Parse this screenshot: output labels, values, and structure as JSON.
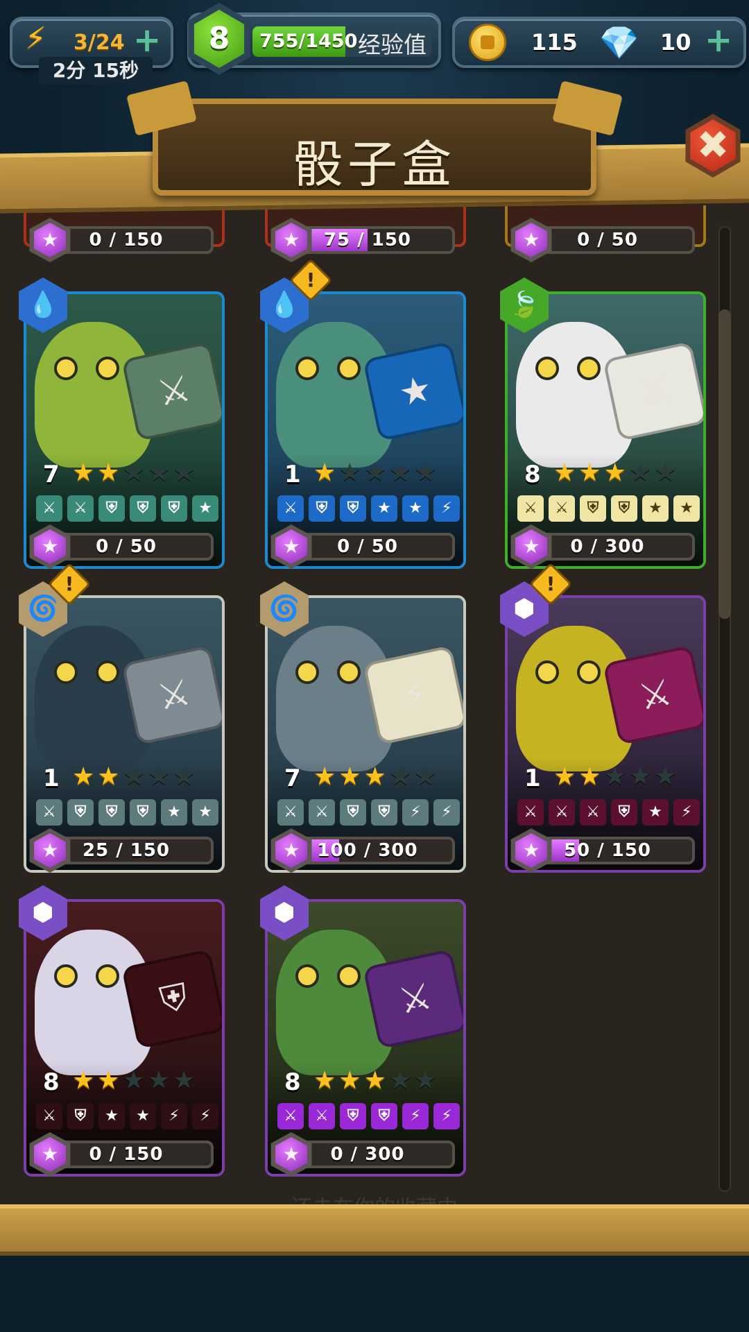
{
  "topbar": {
    "energy": "3/24",
    "energy_timer": "2分 15秒",
    "level": "8",
    "xp": "755/1450",
    "xp_fraction": 0.52,
    "xp_label": "经验值",
    "coins": "115",
    "gems": "10",
    "plus": "+"
  },
  "title": "骰子盒",
  "close_symbol": "✖",
  "footer_text": "还未在你的收藏中",
  "partial_row": [
    {
      "progress": "0 / 150",
      "fraction": 0
    },
    {
      "progress": "75 / 150",
      "fraction": 0.5
    },
    {
      "progress": "0 / 50",
      "fraction": 0
    }
  ],
  "cards": [
    {
      "level": "7",
      "stars": 2,
      "element": "water",
      "element_icon": "💧",
      "alert": false,
      "progress": "0 / 50",
      "fraction": 0,
      "faces": [
        "sword",
        "sword",
        "shield",
        "shield",
        "shield",
        "star"
      ],
      "frame": "#1c8ad0",
      "badge_color": "#2d6fd1",
      "face_bg": "#3a8a78",
      "dice_color": "#5b7f67",
      "dice_glyph": "⚔",
      "char_color": "#8fb63a",
      "bg": "linear-gradient(#2e5a4a,#1a3b2f)"
    },
    {
      "level": "1",
      "stars": 1,
      "element": "water",
      "element_icon": "💧",
      "alert": true,
      "progress": "0 / 50",
      "fraction": 0,
      "faces": [
        "sword",
        "shield",
        "shield",
        "star",
        "star",
        "bolt"
      ],
      "frame": "#1c8ad0",
      "badge_color": "#2d6fd1",
      "face_bg": "#1d6ac8",
      "dice_color": "#1667b8",
      "dice_glyph": "★",
      "char_color": "#4a8f7b",
      "bg": "linear-gradient(#2b5c7a,#183850)"
    },
    {
      "level": "8",
      "stars": 3,
      "element": "nature",
      "element_icon": "🍃",
      "alert": false,
      "progress": "0 / 300",
      "fraction": 0,
      "faces": [
        "sword",
        "sword",
        "shield",
        "shield",
        "star",
        "star"
      ],
      "frame": "#3fae2a",
      "badge_color": "#46a828",
      "face_bg": "#efe6a6",
      "dice_color": "#e8e8e0",
      "dice_glyph": "⚔",
      "char_color": "#eaeaea",
      "bg": "linear-gradient(#3f6a6a,#1e3a2a)"
    },
    {
      "level": "1",
      "stars": 2,
      "element": "neutral",
      "element_icon": "🌀",
      "alert": true,
      "progress": "25 / 150",
      "fraction": 0.167,
      "faces": [
        "sword",
        "shield",
        "shield",
        "shield",
        "star",
        "star"
      ],
      "frame": "#c8c8bc",
      "badge_color": "#b39b6d",
      "face_bg": "#5d7a7c",
      "dice_color": "#7e8b92",
      "dice_glyph": "⚔",
      "char_color": "#2a3d4a",
      "bg": "linear-gradient(#3a5661,#203440)"
    },
    {
      "level": "7",
      "stars": 3,
      "element": "neutral",
      "element_icon": "🌀",
      "alert": false,
      "progress": "100 / 300",
      "fraction": 0.333,
      "faces": [
        "sword",
        "sword",
        "shield",
        "shield",
        "bolt",
        "bolt"
      ],
      "frame": "#c8c8bc",
      "badge_color": "#b39b6d",
      "face_bg": "#5d7a7c",
      "dice_color": "#e8e2c8",
      "dice_glyph": "⚡",
      "char_color": "#6a7f88",
      "bg": "linear-gradient(#3b5663,#1f3440)"
    },
    {
      "level": "1",
      "stars": 2,
      "element": "dark",
      "element_icon": "⬢",
      "alert": true,
      "progress": "50 / 150",
      "fraction": 0.333,
      "faces": [
        "sword",
        "sword",
        "sword",
        "shield",
        "star",
        "bolt"
      ],
      "frame": "#7a3fa8",
      "badge_color": "#7a4fc6",
      "face_bg": "#5c1030",
      "dice_color": "#8a1d5a",
      "dice_glyph": "⚔",
      "char_color": "#c6b322",
      "bg": "linear-gradient(#4a3a5a,#201a2a)"
    },
    {
      "level": "8",
      "stars": 2,
      "element": "dark",
      "element_icon": "⬢",
      "alert": false,
      "progress": "0 / 150",
      "fraction": 0,
      "faces": [
        "sword",
        "shield",
        "star",
        "star",
        "bolt",
        "bolt"
      ],
      "frame": "#7a3fa8",
      "badge_color": "#7a4fc6",
      "face_bg": "#2e0f14",
      "dice_color": "#3a0f14",
      "dice_glyph": "⛨",
      "char_color": "#d9d4e6",
      "bg": "linear-gradient(#4a1c1e,#1c0d10)"
    },
    {
      "level": "8",
      "stars": 3,
      "element": "dark",
      "element_icon": "⬢",
      "alert": false,
      "progress": "0 / 300",
      "fraction": 0,
      "faces": [
        "sword",
        "sword",
        "shield",
        "shield",
        "bolt",
        "bolt"
      ],
      "frame": "#7a3fa8",
      "badge_color": "#7a4fc6",
      "face_bg": "#9a28d6",
      "dice_color": "#5b2a7a",
      "dice_glyph": "⚔",
      "char_color": "#4e8a3c",
      "bg": "linear-gradient(#3c4a2a,#1c2414)"
    }
  ],
  "face_symbols": {
    "sword": "⚔",
    "shield": "⛨",
    "star": "★",
    "bolt": "⚡"
  },
  "gem_glyph": "★",
  "star_glyph": "★"
}
